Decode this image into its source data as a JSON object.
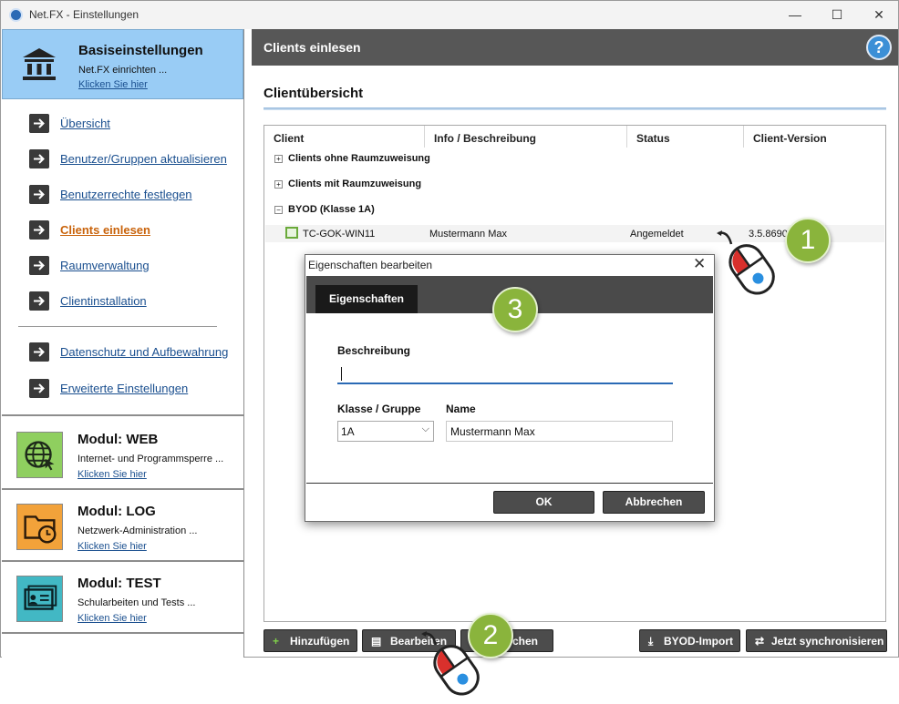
{
  "window": {
    "title": "Net.FX - Einstellungen",
    "minimize": "—",
    "maximize": "☐",
    "close": "✕"
  },
  "sidebar": {
    "basis": {
      "title": "Basiseinstellungen",
      "subtitle": "Net.FX einrichten ...",
      "link": "Klicken Sie hier"
    },
    "items": [
      {
        "label": "Übersicht",
        "active": false
      },
      {
        "label": "Benutzer/Gruppen aktualisieren",
        "active": false
      },
      {
        "label": "Benutzerrechte festlegen",
        "active": false
      },
      {
        "label": "Clients einlesen",
        "active": true
      },
      {
        "label": "Raumverwaltung",
        "active": false
      },
      {
        "label": "Clientinstallation",
        "active": false
      },
      {
        "label": "Datenschutz und Aufbewahrung",
        "active": false
      },
      {
        "label": "Erweiterte Einstellungen",
        "active": false
      }
    ],
    "modules": [
      {
        "title": "Modul: WEB",
        "subtitle": "Internet- und Programmsperre ...",
        "link": "Klicken Sie hier",
        "icon": "globe-cursor-icon",
        "color": "#8fcf5f"
      },
      {
        "title": "Modul: LOG",
        "subtitle": "Netzwerk-Administration ...",
        "link": "Klicken Sie hier",
        "icon": "folder-clock-icon",
        "color": "#f2a23a"
      },
      {
        "title": "Modul: TEST",
        "subtitle": "Schularbeiten und Tests ...",
        "link": "Klicken Sie hier",
        "icon": "id-card-icon",
        "color": "#42b8c4"
      }
    ]
  },
  "main": {
    "header": "Clients einlesen",
    "help": "?",
    "section_title": "Clientübersicht",
    "columns": [
      "Client",
      "Info / Beschreibung",
      "Status",
      "Client-Version"
    ],
    "groups": [
      {
        "label": "Clients ohne Raumzuweisung",
        "expander": "+"
      },
      {
        "label": "Clients mit Raumzuweisung",
        "expander": "+"
      },
      {
        "label": "BYOD (Klasse 1A)",
        "expander": "−"
      }
    ],
    "row": {
      "client": "TC-GOK-WIN11",
      "info": "Mustermann Max",
      "status": "Angemeldet",
      "version": "3.5.8690"
    },
    "buttons": [
      {
        "label": "Hinzufügen",
        "icon": "+"
      },
      {
        "label": "Bearbeiten",
        "icon": "▤"
      },
      {
        "label": "chen",
        "icon": ""
      },
      {
        "label": "BYOD-Import",
        "icon": "⤓"
      },
      {
        "label": "Jetzt synchronisieren",
        "icon": "⇄"
      }
    ]
  },
  "dialog": {
    "title": "Eigenschaften bearbeiten",
    "close": "✕",
    "tab": "Eigenschaften",
    "description_label": "Beschreibung",
    "description_value": "",
    "class_label": "Klasse / Gruppe",
    "class_value": "1A",
    "name_label": "Name",
    "name_value": "Mustermann Max",
    "ok": "OK",
    "cancel": "Abbrechen"
  },
  "badges": [
    "1",
    "2",
    "3"
  ],
  "colors": {
    "accent": "#99ccf5",
    "active_link": "#c9630b",
    "link": "#1a4f8f",
    "badge": "#8ab43c",
    "header": "#575757"
  }
}
